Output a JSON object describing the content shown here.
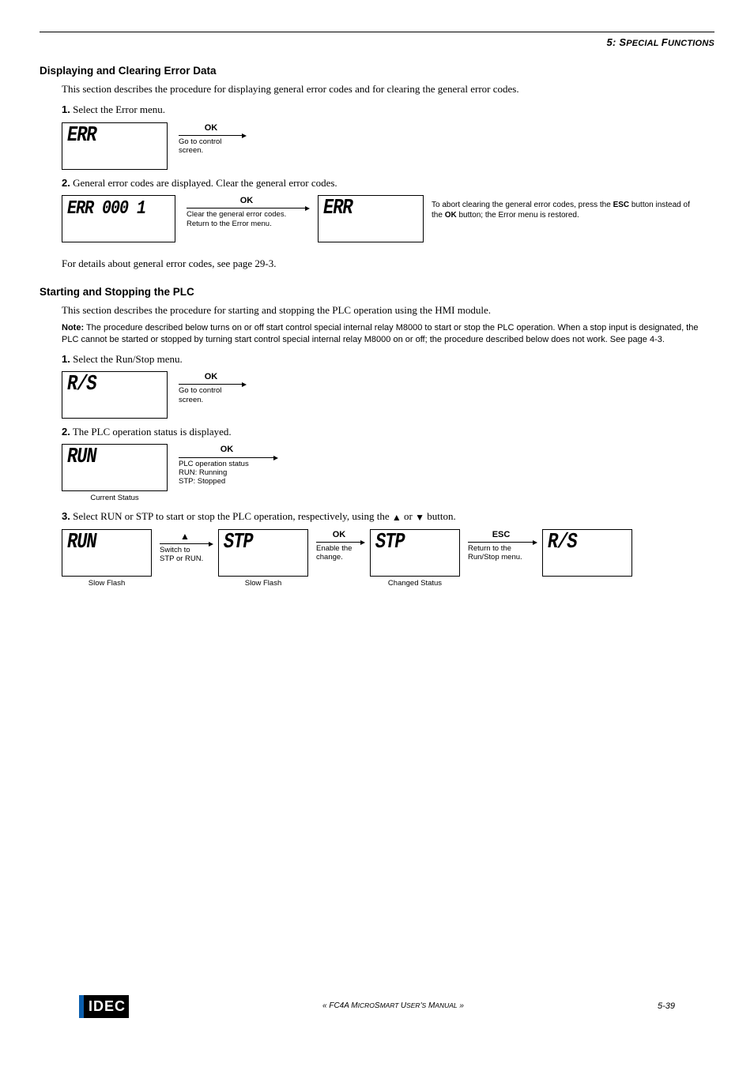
{
  "chapter": {
    "num": "5: ",
    "s1": "S",
    "rest1": "PECIAL ",
    "f": "F",
    "rest2": "UNCTIONS"
  },
  "sec1": {
    "title": "Displaying and Clearing Error Data",
    "intro": "This section describes the procedure for displaying general error codes and for clearing the general error codes.",
    "step1_num": "1.",
    "step1_txt": "Select the Error menu.",
    "lcd1": "ERR",
    "ok": "OK",
    "t1_desc1": "Go to control",
    "t1_desc2": "screen.",
    "step2_num": "2.",
    "step2_txt": "General error codes are displayed. Clear the general error codes.",
    "lcd2": "ERR 000 1",
    "t2_desc1": "Clear the general error codes.",
    "t2_desc2": "Return to the Error menu.",
    "lcd3": "ERR",
    "side_pre": "To abort clearing the general error codes, press the ",
    "side_esc": "ESC",
    "side_mid": " button instead of the ",
    "side_ok": "OK",
    "side_post": " button; the Error menu is restored.",
    "outro": "For details about general error codes, see page 29-3."
  },
  "sec2": {
    "title": "Starting and Stopping the PLC",
    "intro": "This section describes the procedure for starting and stopping the PLC operation using the HMI module.",
    "note_b": "Note:",
    "note_txt": " The procedure described below turns on or off start control special internal relay M8000 to start or stop the PLC operation. When a stop input is designated, the PLC cannot be started or stopped by turning start control special internal relay M8000 on or off; the procedure described below does not work. See page 4-3.",
    "step1_num": "1.",
    "step1_txt": "Select the Run/Stop menu.",
    "lcd_rs": "R/S",
    "ok": "OK",
    "t1_desc1": "Go to control",
    "t1_desc2": "screen.",
    "step2_num": "2.",
    "step2_txt": "The PLC operation status is displayed.",
    "lcd_run": "RUN",
    "t2_desc1": "PLC operation status",
    "t2_desc2": "RUN: Running",
    "t2_desc3": "STP:  Stopped",
    "cap_current": "Current Status",
    "step3_num": "3.",
    "step3_pre": "Select RUN or STP to start or stop the PLC operation, respectively, using the ",
    "up": "▲",
    "or": " or ",
    "down": "▼",
    "step3_post": " button.",
    "lcd_run2": "RUN",
    "cap_sf": "Slow Flash",
    "t_up": "▲",
    "t_up_desc1": "Switch to",
    "t_up_desc2": "STP or RUN.",
    "lcd_stp1": "STP",
    "t_ok_desc1": "Enable the",
    "t_ok_desc2": "change.",
    "lcd_stp2": "STP",
    "cap_changed": "Changed Status",
    "esc": "ESC",
    "t_esc_desc1": "Return to the",
    "t_esc_desc2": "Run/Stop menu.",
    "lcd_rs2": "R/S"
  },
  "footer": {
    "logo": "IDEC",
    "center_pre": "« FC4A M",
    "center_s1": "ICRO",
    "center_mid": "S",
    "center_s2": "MART ",
    "center_u": "U",
    "center_s3": "SER",
    "center_ap": "'",
    "center_s4": "S",
    "center_m": " M",
    "center_s5": "ANUAL",
    "center_post": " »",
    "page": "5-39"
  }
}
